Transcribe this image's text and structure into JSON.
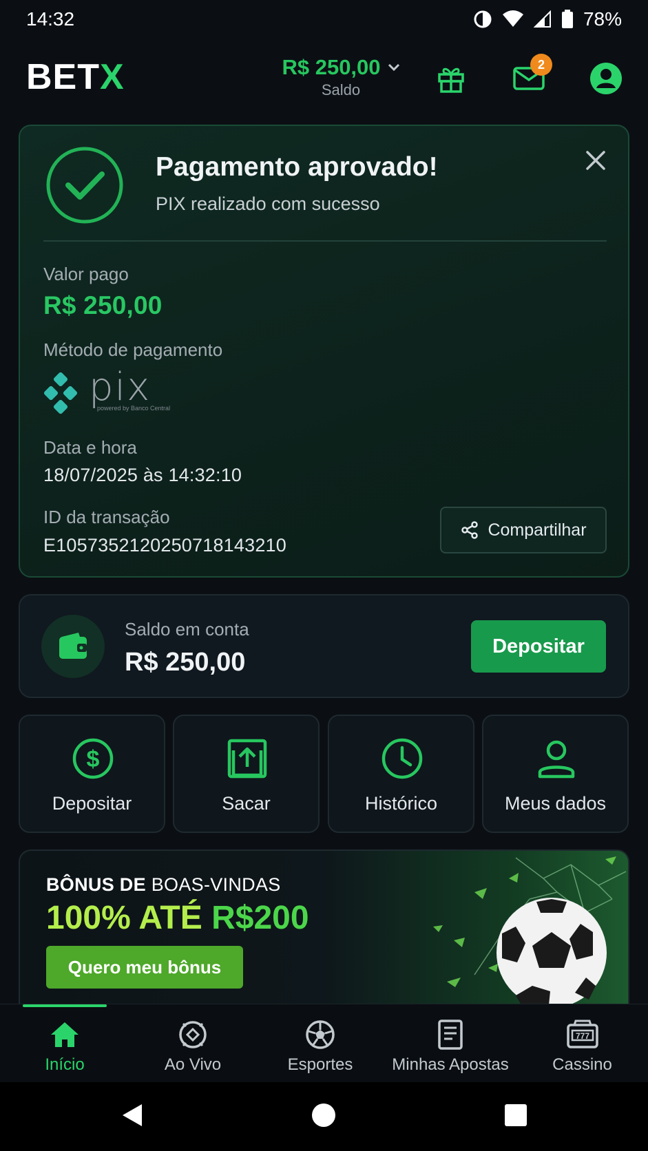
{
  "status": {
    "time": "14:32",
    "battery": "78%"
  },
  "header": {
    "logo_main": "BET",
    "logo_accent": "X",
    "balance": "R$ 250,00",
    "balance_label": "Saldo",
    "notifications_count": "2"
  },
  "payment": {
    "title": "Pagamento aprovado!",
    "subtitle": "PIX realizado com sucesso",
    "amount_label": "Valor pago",
    "amount": "R$ 250,00",
    "method_label": "Método de pagamento",
    "method_logo_text": "pix",
    "method_logo_caption": "powered by Banco Central",
    "datetime_label": "Data e hora",
    "datetime": "18/07/2025 às 14:32:10",
    "txid_label": "ID da transação",
    "txid": "E10573521202507181432​10",
    "share_label": "Compartilhar"
  },
  "account": {
    "label": "Saldo em conta",
    "value": "R$ 250,00",
    "deposit_label": "Depositar"
  },
  "quick_actions": [
    {
      "label": "Depositar",
      "icon": "dollar-icon"
    },
    {
      "label": "Sacar",
      "icon": "upload-icon"
    },
    {
      "label": "Histórico",
      "icon": "clock-icon"
    },
    {
      "label": "Meus dados",
      "icon": "user-icon"
    }
  ],
  "promo": {
    "line1_bold": "BÔNUS DE",
    "line1_thin": " BOAS-VINDAS",
    "line2_a": "100% ATÉ ",
    "line2_b": "R$200",
    "button": "Quero meu bônus"
  },
  "bottom_nav": [
    {
      "label": "Início",
      "icon": "home-icon",
      "active": true
    },
    {
      "label": "Ao Vivo",
      "icon": "live-icon"
    },
    {
      "label": "Esportes",
      "icon": "soccer-ball-icon"
    },
    {
      "label": "Minhas Apostas",
      "icon": "ticket-icon"
    },
    {
      "label": "Cassino",
      "icon": "slot-machine-icon"
    }
  ],
  "colors": {
    "accent": "#2bd46b",
    "background": "#0b0f14",
    "card_green": "#0f2a22",
    "button_green": "#189a4c",
    "badge_orange": "#f08a1c"
  }
}
